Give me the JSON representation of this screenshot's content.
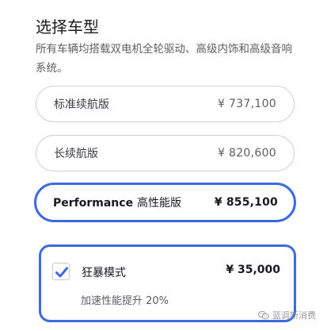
{
  "header": {
    "title": "选择车型",
    "description": "所有车辆均搭载双电机全轮驱动、高级内饰和高级音响系统。"
  },
  "variants": [
    {
      "name": "标准续航版",
      "price": "¥ 737,100"
    },
    {
      "name": "长续航版",
      "price": "¥ 820,600"
    },
    {
      "name_en": "Performance",
      "name_cn": "高性能版",
      "price": "¥ 855,100",
      "selected": true
    }
  ],
  "addon": {
    "checked": true,
    "name": "狂暴模式",
    "price": "¥ 35,000",
    "subtitle": "加速性能提升 20%"
  },
  "watermark": {
    "text": "蓝调新消费",
    "icon": "wechat-icon"
  },
  "colors": {
    "accent": "#3e6ae1",
    "text_primary": "#171a20",
    "text_secondary": "#5c5e62",
    "border": "#d0d1d2"
  }
}
